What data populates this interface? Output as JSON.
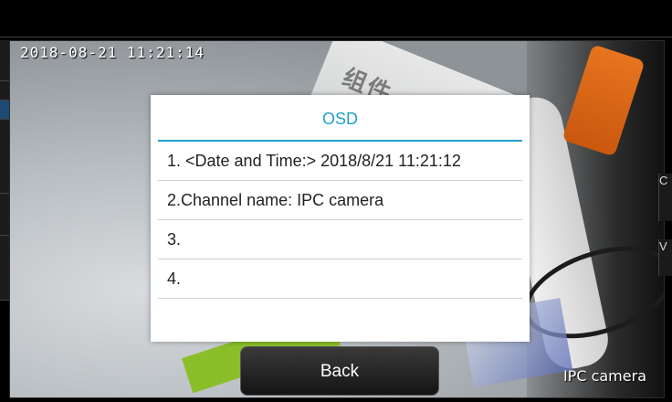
{
  "osd_overlay": {
    "timestamp": "2018-08-21 11:21:14",
    "channel_label": "IPC camera"
  },
  "scene": {
    "box_print": "组件"
  },
  "side_glyphs": {
    "right_c": "C",
    "right_v": "V"
  },
  "dialog": {
    "title": "OSD",
    "rows": [
      "1. <Date and Time:> 2018/8/21 11:21:12",
      "2.Channel name: IPC camera",
      "3.",
      "4."
    ]
  },
  "buttons": {
    "back_label": "Back"
  },
  "colors": {
    "accent": "#1fa0c8",
    "dialog_bg": "#ffffff",
    "button_bg": "#1e1e1e"
  }
}
